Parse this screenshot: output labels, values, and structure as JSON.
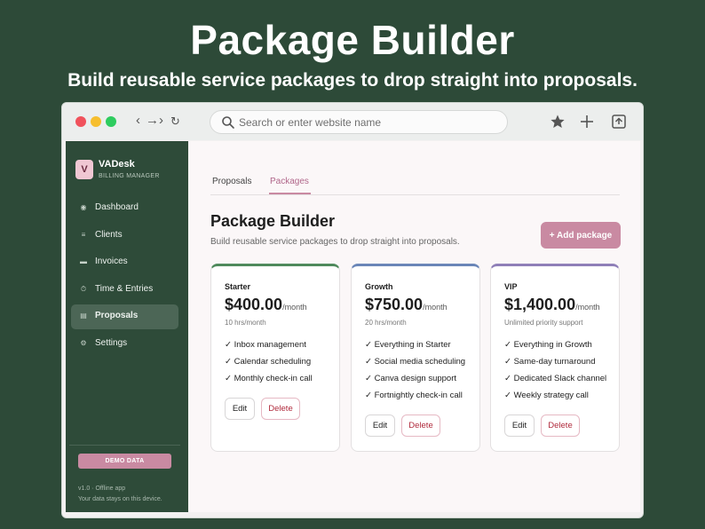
{
  "hero": {
    "title": "Package Builder",
    "subtitle": "Build reusable service packages to drop straight into proposals."
  },
  "browser": {
    "nav_glyphs": [
      "‹",
      "→",
      "›",
      "↻"
    ],
    "search_placeholder": "Search or enter website name",
    "icons": [
      "star-icon",
      "plus-icon",
      "share-icon"
    ]
  },
  "sidebar": {
    "brand_initial": "V",
    "brand_name": "VADesk",
    "brand_subtitle": "BILLING MANAGER",
    "items": [
      {
        "label": "Dashboard",
        "icon": "◉",
        "active": false
      },
      {
        "label": "Clients",
        "icon": "≡",
        "active": false
      },
      {
        "label": "Invoices",
        "icon": "▬",
        "active": false
      },
      {
        "label": "Time & Entries",
        "icon": "⏱",
        "active": false
      },
      {
        "label": "Proposals",
        "icon": "▤",
        "active": true
      },
      {
        "label": "Settings",
        "icon": "⚙",
        "active": false
      }
    ],
    "demo_badge": "DEMO DATA",
    "footer_version": "v1.0 · Offline app",
    "footer_note": "Your data stays on this device."
  },
  "main": {
    "tabs": [
      {
        "label": "Proposals",
        "active": false
      },
      {
        "label": "Packages",
        "active": true
      }
    ],
    "title": "Package Builder",
    "subtitle": "Build reusable service packages to drop straight into proposals.",
    "add_button": "+ Add package",
    "edit_label": "Edit",
    "delete_label": "Delete",
    "packages": [
      {
        "name": "Starter",
        "price": "$400.00",
        "period": "/month",
        "hours": "10 hrs/month",
        "accent": "#4f8a5c",
        "features": [
          "✓ Inbox management",
          "✓ Calendar scheduling",
          "✓ Monthly check-in call"
        ]
      },
      {
        "name": "Growth",
        "price": "$750.00",
        "period": "/month",
        "hours": "20 hrs/month",
        "accent": "#6a86b8",
        "features": [
          "✓ Everything in Starter",
          "✓ Social media scheduling",
          "✓ Canva design support",
          "✓ Fortnightly check-in call"
        ]
      },
      {
        "name": "VIP",
        "price": "$1,400.00",
        "period": "/month",
        "hours": "Unlimited priority support",
        "accent": "#8f7fb8",
        "features": [
          "✓ Everything in Growth",
          "✓ Same-day turnaround",
          "✓ Dedicated Slack channel",
          "✓ Weekly strategy call"
        ]
      }
    ]
  },
  "colors": {
    "background": "#2d4a38",
    "sidebar": "#2e4b39",
    "accent_pink": "#c98aa2",
    "delete_red": "#b02a3c"
  }
}
